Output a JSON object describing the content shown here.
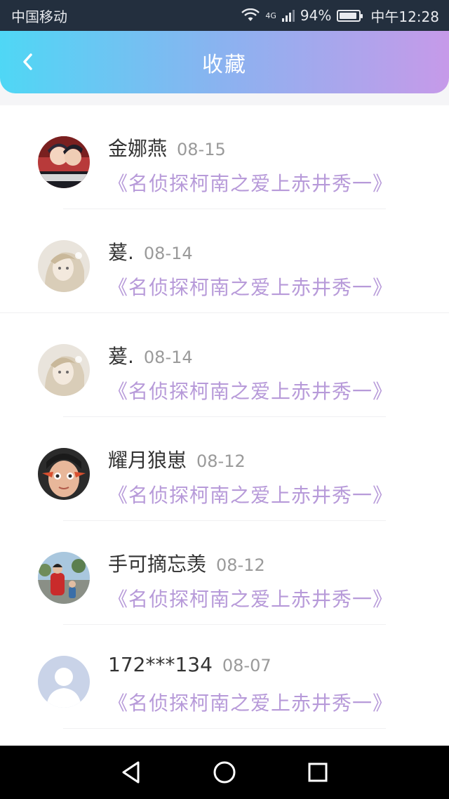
{
  "status_bar": {
    "carrier": "中国移动",
    "network": "4G",
    "battery": "94%",
    "battery_level": 0.94,
    "time": "中午12:28"
  },
  "header": {
    "title": "收藏",
    "back_icon": "back-chevron-icon"
  },
  "favorites": [
    {
      "name": "金娜燕",
      "date": "08-15",
      "title": "《名侦探柯南之爱上赤井秀一》",
      "avatar": "anime-avatar"
    },
    {
      "name": "萲.",
      "date": "08-14",
      "title": "《名侦探柯南之爱上赤井秀一》",
      "avatar": "illustration-girl-avatar"
    },
    {
      "name": "萲.",
      "date": "08-14",
      "title": "《名侦探柯南之爱上赤井秀一》",
      "avatar": "illustration-girl-avatar"
    },
    {
      "name": "耀月狼崽",
      "date": "08-12",
      "title": "《名侦探柯南之爱上赤井秀一》",
      "avatar": "photo-avatar"
    },
    {
      "name": "手可摘忘羡",
      "date": "08-12",
      "title": "《名侦探柯南之爱上赤井秀一》",
      "avatar": "photo-outdoor-avatar"
    },
    {
      "name": "172***134",
      "date": "08-07",
      "title": "《名侦探柯南之爱上赤井秀一》",
      "avatar": "default-user-avatar"
    }
  ],
  "nav_bar": {
    "back": "triangle-back-icon",
    "home": "circle-home-icon",
    "recent": "square-recent-icon"
  },
  "colors": {
    "header_gradient_start": "#4fd7f5",
    "header_gradient_end": "#c69ae9",
    "book_title": "#b79ad9",
    "status_bar_bg": "#232f3e"
  }
}
